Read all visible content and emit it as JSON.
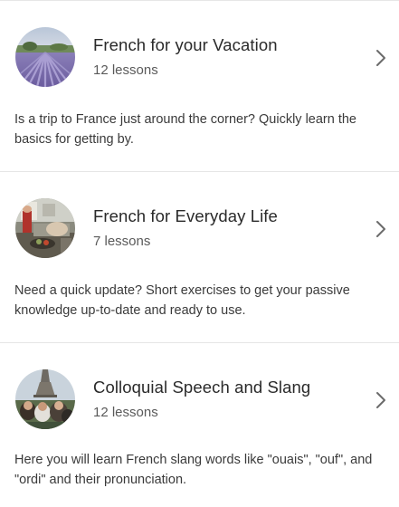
{
  "courses": [
    {
      "title": "French for your Vacation",
      "lessons": "12 lessons",
      "description": "Is a trip to France just around the corner? Quickly learn the basics for getting by.",
      "image_icon": "lavender-field-photo"
    },
    {
      "title": "French for Everyday Life",
      "lessons": "7 lessons",
      "description": "Need a quick update? Short exercises to get your passive knowledge up-to-date and ready to use.",
      "image_icon": "kitchen-photo"
    },
    {
      "title": "Colloquial Speech and Slang",
      "lessons": "12 lessons",
      "description": "Here you will learn French slang words like \"ouais\", \"ouf\", and \"ordi\" and their pronunciation.",
      "image_icon": "eiffel-tower-friends-photo"
    }
  ],
  "chevron_icon": "chevron-right-icon",
  "colors": {
    "divider": "#e6e6e6",
    "title": "#2a2a2a",
    "subtitle": "#5a5a5a",
    "chevron": "#6b6b6b"
  }
}
